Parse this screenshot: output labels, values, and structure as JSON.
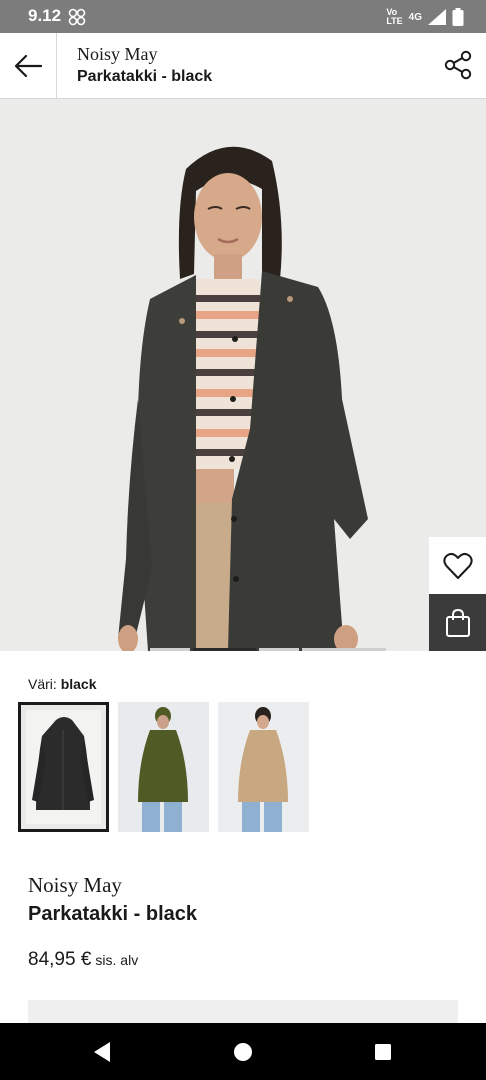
{
  "status_bar": {
    "time": "9.12",
    "network_top": "Vo",
    "network_bottom": "LTE",
    "signal_label": "4G",
    "icons": [
      "app-notification-icon",
      "wifi-calling-icon",
      "signal-icon",
      "battery-icon"
    ]
  },
  "header": {
    "brand": "Noisy May",
    "title": "Parkatakki - black",
    "back_icon": "arrow-left-icon",
    "share_icon": "share-icon"
  },
  "hero": {
    "wishlist_icon": "heart-icon",
    "bag_icon": "shopping-bag-icon",
    "carousel_pages": 4,
    "carousel_active_index": 1
  },
  "color": {
    "label": "Väri:",
    "selected": "black",
    "swatches": [
      {
        "name": "black",
        "selected": true,
        "color": "#2b2b2b"
      },
      {
        "name": "olive",
        "selected": false,
        "color": "#4f5a25"
      },
      {
        "name": "beige",
        "selected": false,
        "color": "#c8a880"
      }
    ]
  },
  "product": {
    "brand": "Noisy May",
    "name": "Parkatakki - black",
    "price": "84,95 €",
    "price_note": "sis. alv"
  },
  "nav": {
    "icons": [
      "back-triangle-icon",
      "home-circle-icon",
      "recents-square-icon"
    ]
  }
}
